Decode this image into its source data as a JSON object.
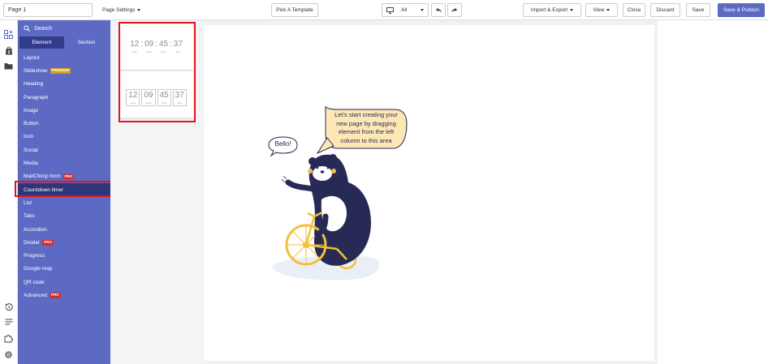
{
  "topbar": {
    "page_name": "Page 1",
    "page_settings": "Page Settings",
    "pick_template": "Pick A Template",
    "device_value": "All",
    "import_export": "Import & Export",
    "view": "View",
    "close": "Close",
    "discard": "Discard",
    "save": "Save",
    "save_publish": "Save & Publish"
  },
  "panel": {
    "search": "Search",
    "tabs": [
      "Element",
      "Section"
    ],
    "items": [
      {
        "label": "Layout"
      },
      {
        "label": "Slideshow",
        "badge": "PREMIUM"
      },
      {
        "label": "Heading"
      },
      {
        "label": "Paragraph"
      },
      {
        "label": "Image"
      },
      {
        "label": "Button"
      },
      {
        "label": "Icon"
      },
      {
        "label": "Social"
      },
      {
        "label": "Media"
      },
      {
        "label": "MailChimp form",
        "badge": "PRO"
      },
      {
        "label": "Countdown timer"
      },
      {
        "label": "List"
      },
      {
        "label": "Tabs"
      },
      {
        "label": "Accordion"
      },
      {
        "label": "Divider",
        "badge": "PRO"
      },
      {
        "label": "Progress"
      },
      {
        "label": "Google map"
      },
      {
        "label": "QR code"
      },
      {
        "label": "Advanced",
        "badge": "PRO"
      }
    ]
  },
  "preview": {
    "units": [
      {
        "num": "12",
        "label": "Days"
      },
      {
        "num": "09",
        "label": "Hours"
      },
      {
        "num": "45",
        "label": "Mins"
      },
      {
        "num": "37",
        "label": "Secs"
      }
    ]
  },
  "canvas": {
    "hello": "Bello!",
    "message": [
      "Let's start creating your",
      "new page by dragging",
      "element from the left",
      "column to this area"
    ]
  },
  "colors": {
    "accent": "#5c6ac4",
    "selected": "#2e3579",
    "highlight": "#e0141e",
    "bear": "#272a55",
    "wheel": "#f2c135"
  }
}
